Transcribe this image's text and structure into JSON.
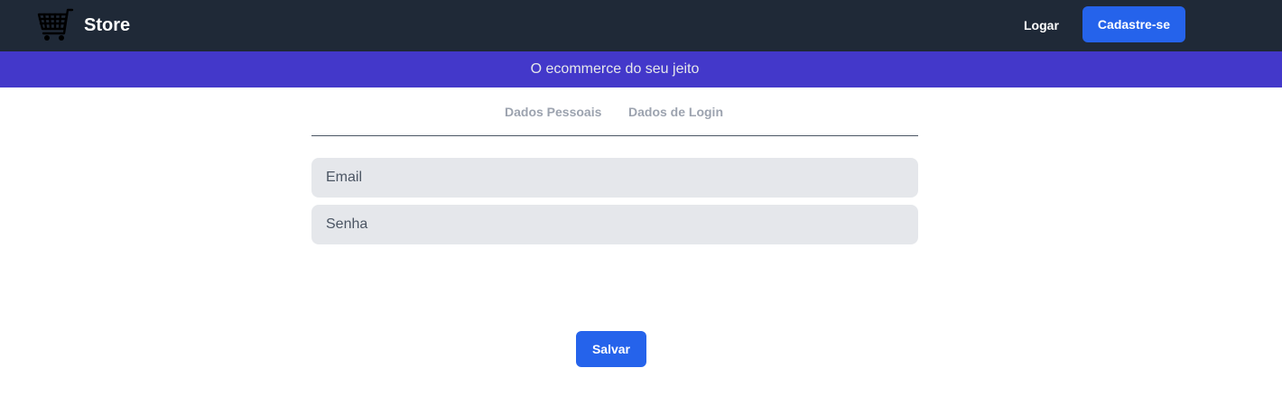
{
  "navbar": {
    "logo_icon": "shopping-cart-icon",
    "brand": "Store",
    "login_label": "Logar",
    "signup_label": "Cadastre-se",
    "background_color": "#1f2937",
    "accent_color": "#2563eb"
  },
  "banner": {
    "text": "O ecommerce do seu jeito",
    "background_color": "#4338ca"
  },
  "tabs": [
    {
      "label": "Dados Pessoais"
    },
    {
      "label": "Dados de Login"
    }
  ],
  "form": {
    "email_placeholder": "Email",
    "password_placeholder": "Senha",
    "save_label": "Salvar"
  }
}
